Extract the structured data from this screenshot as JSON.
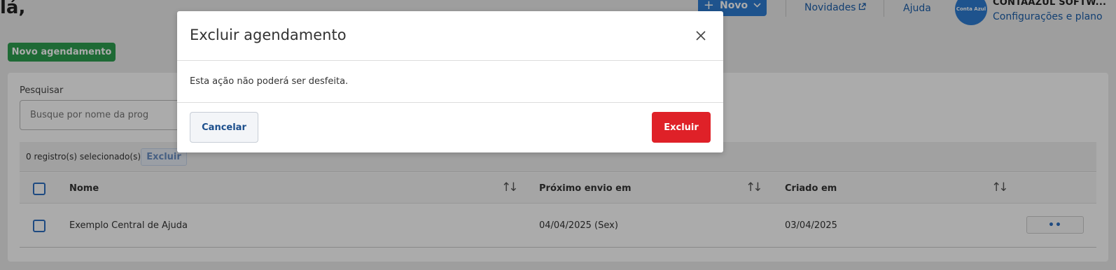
{
  "header": {
    "greeting": "lá,",
    "novo_label": "Novo",
    "novidades_label": "Novidades",
    "ajuda_label": "Ajuda",
    "avatar_text": "Conta Azul",
    "company_name": "CONTAAZUL SOFTW...",
    "config_link": "Configurações e plano"
  },
  "actions": {
    "novo_agendamento": "Novo agendamento"
  },
  "search": {
    "label": "Pesquisar",
    "placeholder": "Busque por nome da prog"
  },
  "selection": {
    "text": "0 registro(s) selecionado(s)",
    "excluir_label": "Excluir"
  },
  "table": {
    "columns": [
      "Nome",
      "Próximo envio em",
      "Criado em"
    ],
    "rows": [
      {
        "nome": "Exemplo Central de Ajuda",
        "proximo_envio": "04/04/2025 (Sex)",
        "criado_em": "03/04/2025",
        "more": "••"
      }
    ]
  },
  "modal": {
    "title": "Excluir agendamento",
    "body": "Esta ação não poderá ser desfeita.",
    "cancel_label": "Cancelar",
    "confirm_label": "Excluir"
  },
  "colors": {
    "primary": "#2d7dd2",
    "success": "#2e9e4f",
    "danger": "#df2128",
    "link": "#1b5fab"
  }
}
